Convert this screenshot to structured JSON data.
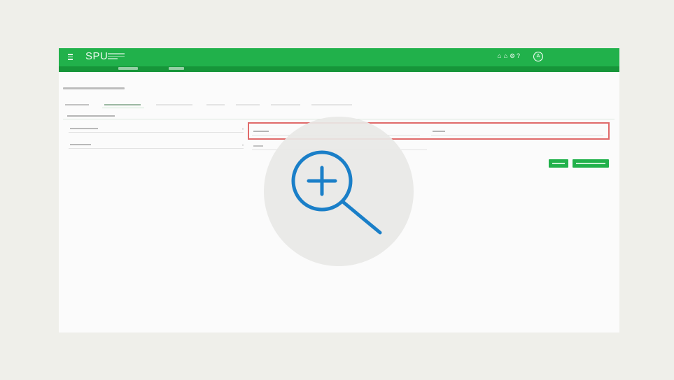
{
  "app": {
    "brand": "SPU",
    "avatar_initial": "A"
  },
  "page": {
    "title": "",
    "section_label": ""
  },
  "tabs": [
    {
      "label": "",
      "active": false
    },
    {
      "label": "",
      "active": true
    },
    {
      "label": "",
      "active": false
    },
    {
      "label": "",
      "active": false
    },
    {
      "label": "",
      "active": false
    },
    {
      "label": "",
      "active": false
    },
    {
      "label": "",
      "active": false
    }
  ],
  "fields": {
    "field_1": {
      "value": ""
    },
    "field_2": {
      "value": ""
    },
    "field_3": {
      "value": ""
    },
    "field_4": {
      "value": ""
    },
    "field_5": {
      "value": ""
    }
  },
  "buttons": {
    "primary_label": "",
    "secondary_label": ""
  },
  "icons": {
    "menu": "hamburger-menu-icon",
    "zoom": "zoom-in-icon",
    "topbar": [
      "home-icon",
      "home-icon",
      "gear-icon",
      "help-icon"
    ]
  },
  "colors": {
    "brand_green": "#21b14b",
    "brand_green_dark": "#169539",
    "highlight_red": "#e06a6a",
    "zoom_blue": "#1a7fc8"
  }
}
